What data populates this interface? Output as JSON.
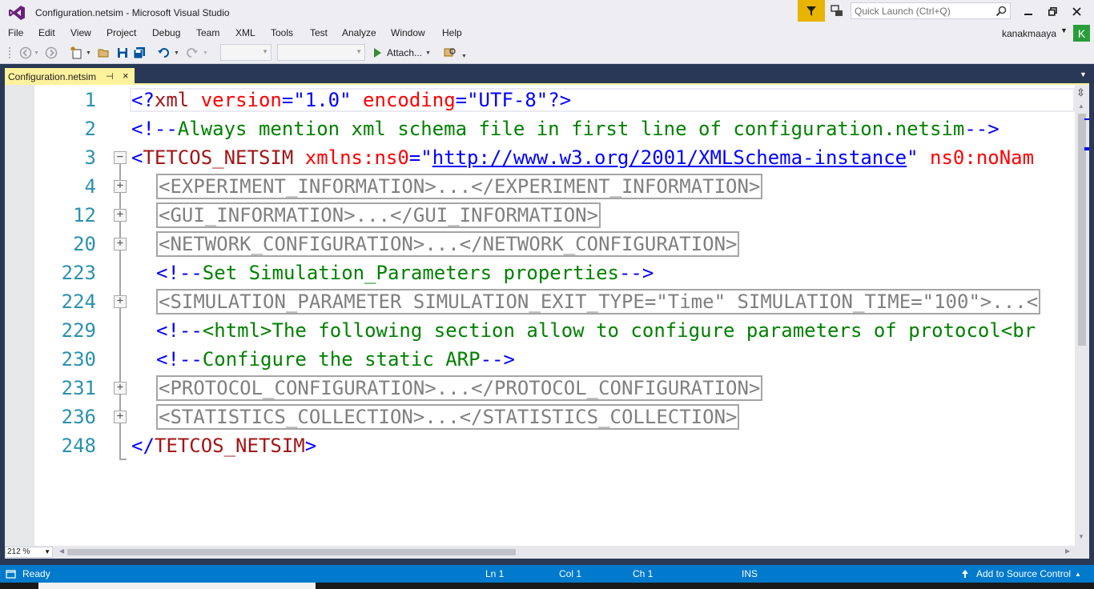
{
  "window": {
    "title": "Configuration.netsim - Microsoft Visual Studio"
  },
  "quick_launch": {
    "placeholder": "Quick Launch (Ctrl+Q)"
  },
  "menu": {
    "items": [
      "File",
      "Edit",
      "View",
      "Project",
      "Debug",
      "Team",
      "XML",
      "Tools",
      "Test",
      "Analyze",
      "Window",
      "Help"
    ]
  },
  "user": {
    "name": "kanakmaaya",
    "initial": "K"
  },
  "toolbar": {
    "attach_label": "Attach..."
  },
  "tab": {
    "label": "Configuration.netsim"
  },
  "editor": {
    "zoom": "212 %",
    "lines": [
      {
        "num": "1",
        "parts": [
          {
            "c": "blu",
            "t": "<?"
          },
          {
            "c": "red",
            "t": "xml"
          },
          {
            "c": "blu",
            "t": " "
          },
          {
            "c": "attr",
            "t": "version"
          },
          {
            "c": "blu",
            "t": "=\""
          },
          {
            "c": "blu",
            "t": "1.0"
          },
          {
            "c": "blu",
            "t": "\" "
          },
          {
            "c": "attr",
            "t": "encoding"
          },
          {
            "c": "blu",
            "t": "=\""
          },
          {
            "c": "blu",
            "t": "UTF-8"
          },
          {
            "c": "blu",
            "t": "\"?>"
          }
        ]
      },
      {
        "num": "2",
        "parts": [
          {
            "c": "blu",
            "t": "<!--"
          },
          {
            "c": "grn",
            "t": "Always mention xml schema file in first line of configuration.netsim"
          },
          {
            "c": "blu",
            "t": "-->"
          }
        ]
      },
      {
        "num": "3",
        "parts": [
          {
            "c": "blu",
            "t": "<"
          },
          {
            "c": "red",
            "t": "TETCOS_NETSIM"
          },
          {
            "c": "blu",
            "t": " "
          },
          {
            "c": "attr",
            "t": "xmlns:ns0"
          },
          {
            "c": "blu",
            "t": "=\""
          },
          {
            "c": "lnk",
            "t": "http://www.w3.org/2001/XMLSchema-instance"
          },
          {
            "c": "blu",
            "t": "\" "
          },
          {
            "c": "attr",
            "t": "ns0:noNam"
          }
        ]
      },
      {
        "num": "4",
        "collapsed": "<EXPERIMENT_INFORMATION>...</EXPERIMENT_INFORMATION>"
      },
      {
        "num": "12",
        "collapsed": "<GUI_INFORMATION>...</GUI_INFORMATION>"
      },
      {
        "num": "20",
        "collapsed": "<NETWORK_CONFIGURATION>...</NETWORK_CONFIGURATION>"
      },
      {
        "num": "223",
        "parts": [
          {
            "c": "blu",
            "t": "<!--"
          },
          {
            "c": "grn",
            "t": "Set Simulation_Parameters properties"
          },
          {
            "c": "blu",
            "t": "-->"
          }
        ]
      },
      {
        "num": "224",
        "collapsed": "<SIMULATION_PARAMETER SIMULATION_EXIT_TYPE=\"Time\" SIMULATION_TIME=\"100\">...<"
      },
      {
        "num": "229",
        "parts": [
          {
            "c": "blu",
            "t": "<!--"
          },
          {
            "c": "grn",
            "t": "<html>The following section allow to configure parameters of protocol<br"
          }
        ]
      },
      {
        "num": "230",
        "parts": [
          {
            "c": "blu",
            "t": "<!--"
          },
          {
            "c": "grn",
            "t": "Configure the static ARP"
          },
          {
            "c": "blu",
            "t": "-->"
          }
        ]
      },
      {
        "num": "231",
        "collapsed": "<PROTOCOL_CONFIGURATION>...</PROTOCOL_CONFIGURATION>"
      },
      {
        "num": "236",
        "collapsed": "<STATISTICS_COLLECTION>...</STATISTICS_COLLECTION>"
      },
      {
        "num": "248",
        "parts": [
          {
            "c": "blu",
            "t": "</"
          },
          {
            "c": "red",
            "t": "TETCOS_NETSIM"
          },
          {
            "c": "blu",
            "t": ">"
          }
        ]
      }
    ]
  },
  "status": {
    "state": "Ready",
    "line": "Ln 1",
    "col": "Col 1",
    "ch": "Ch 1",
    "mode": "INS",
    "source_control": "Add to Source Control"
  },
  "colors": {
    "accent": "#007acc",
    "tab_active": "#fff29d",
    "chrome": "#eeeef2",
    "frame": "#293955",
    "line_number": "#2b91af"
  }
}
